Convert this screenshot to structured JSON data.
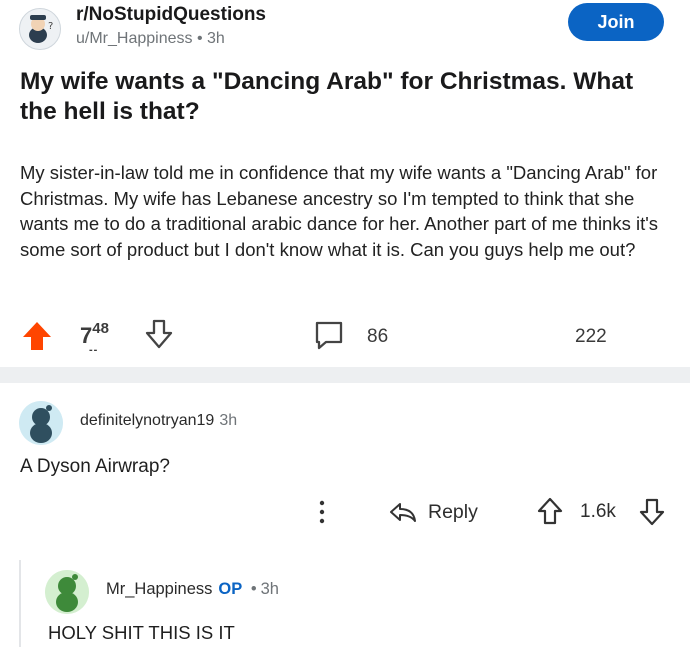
{
  "header": {
    "subreddit": "r/NoStupidQuestions",
    "author": "u/Mr_Happiness",
    "separator": "•",
    "age": "3h",
    "join_label": "Join"
  },
  "post": {
    "title": "My wife wants a \"Dancing Arab\" for Christmas. What the hell is that?",
    "body": "My sister-in-law told me in confidence that my wife wants a \"Dancing Arab\" for Christmas. My wife has Lebanese ancestry so I'm tempted to think that she wants me to do a traditional arabic dance for her. Another part of me thinks it's some sort of product but I don't know what it is. Can you guys help me out?",
    "vote_count_lead": "7",
    "vote_count_rest": "48",
    "vote_count_smudge": "--",
    "comment_count": "86",
    "share_count": "222"
  },
  "comments": [
    {
      "username": "definitelynotryan19",
      "age": "3h",
      "text": "A Dyson Airwrap?",
      "reply_label": "Reply",
      "score": "1.6k"
    },
    {
      "username": "Mr_Happiness",
      "op_badge": "OP",
      "separator": "•",
      "age": "3h",
      "text": "HOLY SHIT THIS IS IT"
    }
  ],
  "colors": {
    "join": "#0b64c4",
    "upvote": "#ff4500",
    "op": "#0b64c4",
    "divider": "#edeff1"
  },
  "icons": [
    "subreddit-avatar",
    "upvote-icon",
    "downvote-icon",
    "comment-icon",
    "more-options-icon",
    "reply-icon",
    "user-avatar-icon"
  ]
}
